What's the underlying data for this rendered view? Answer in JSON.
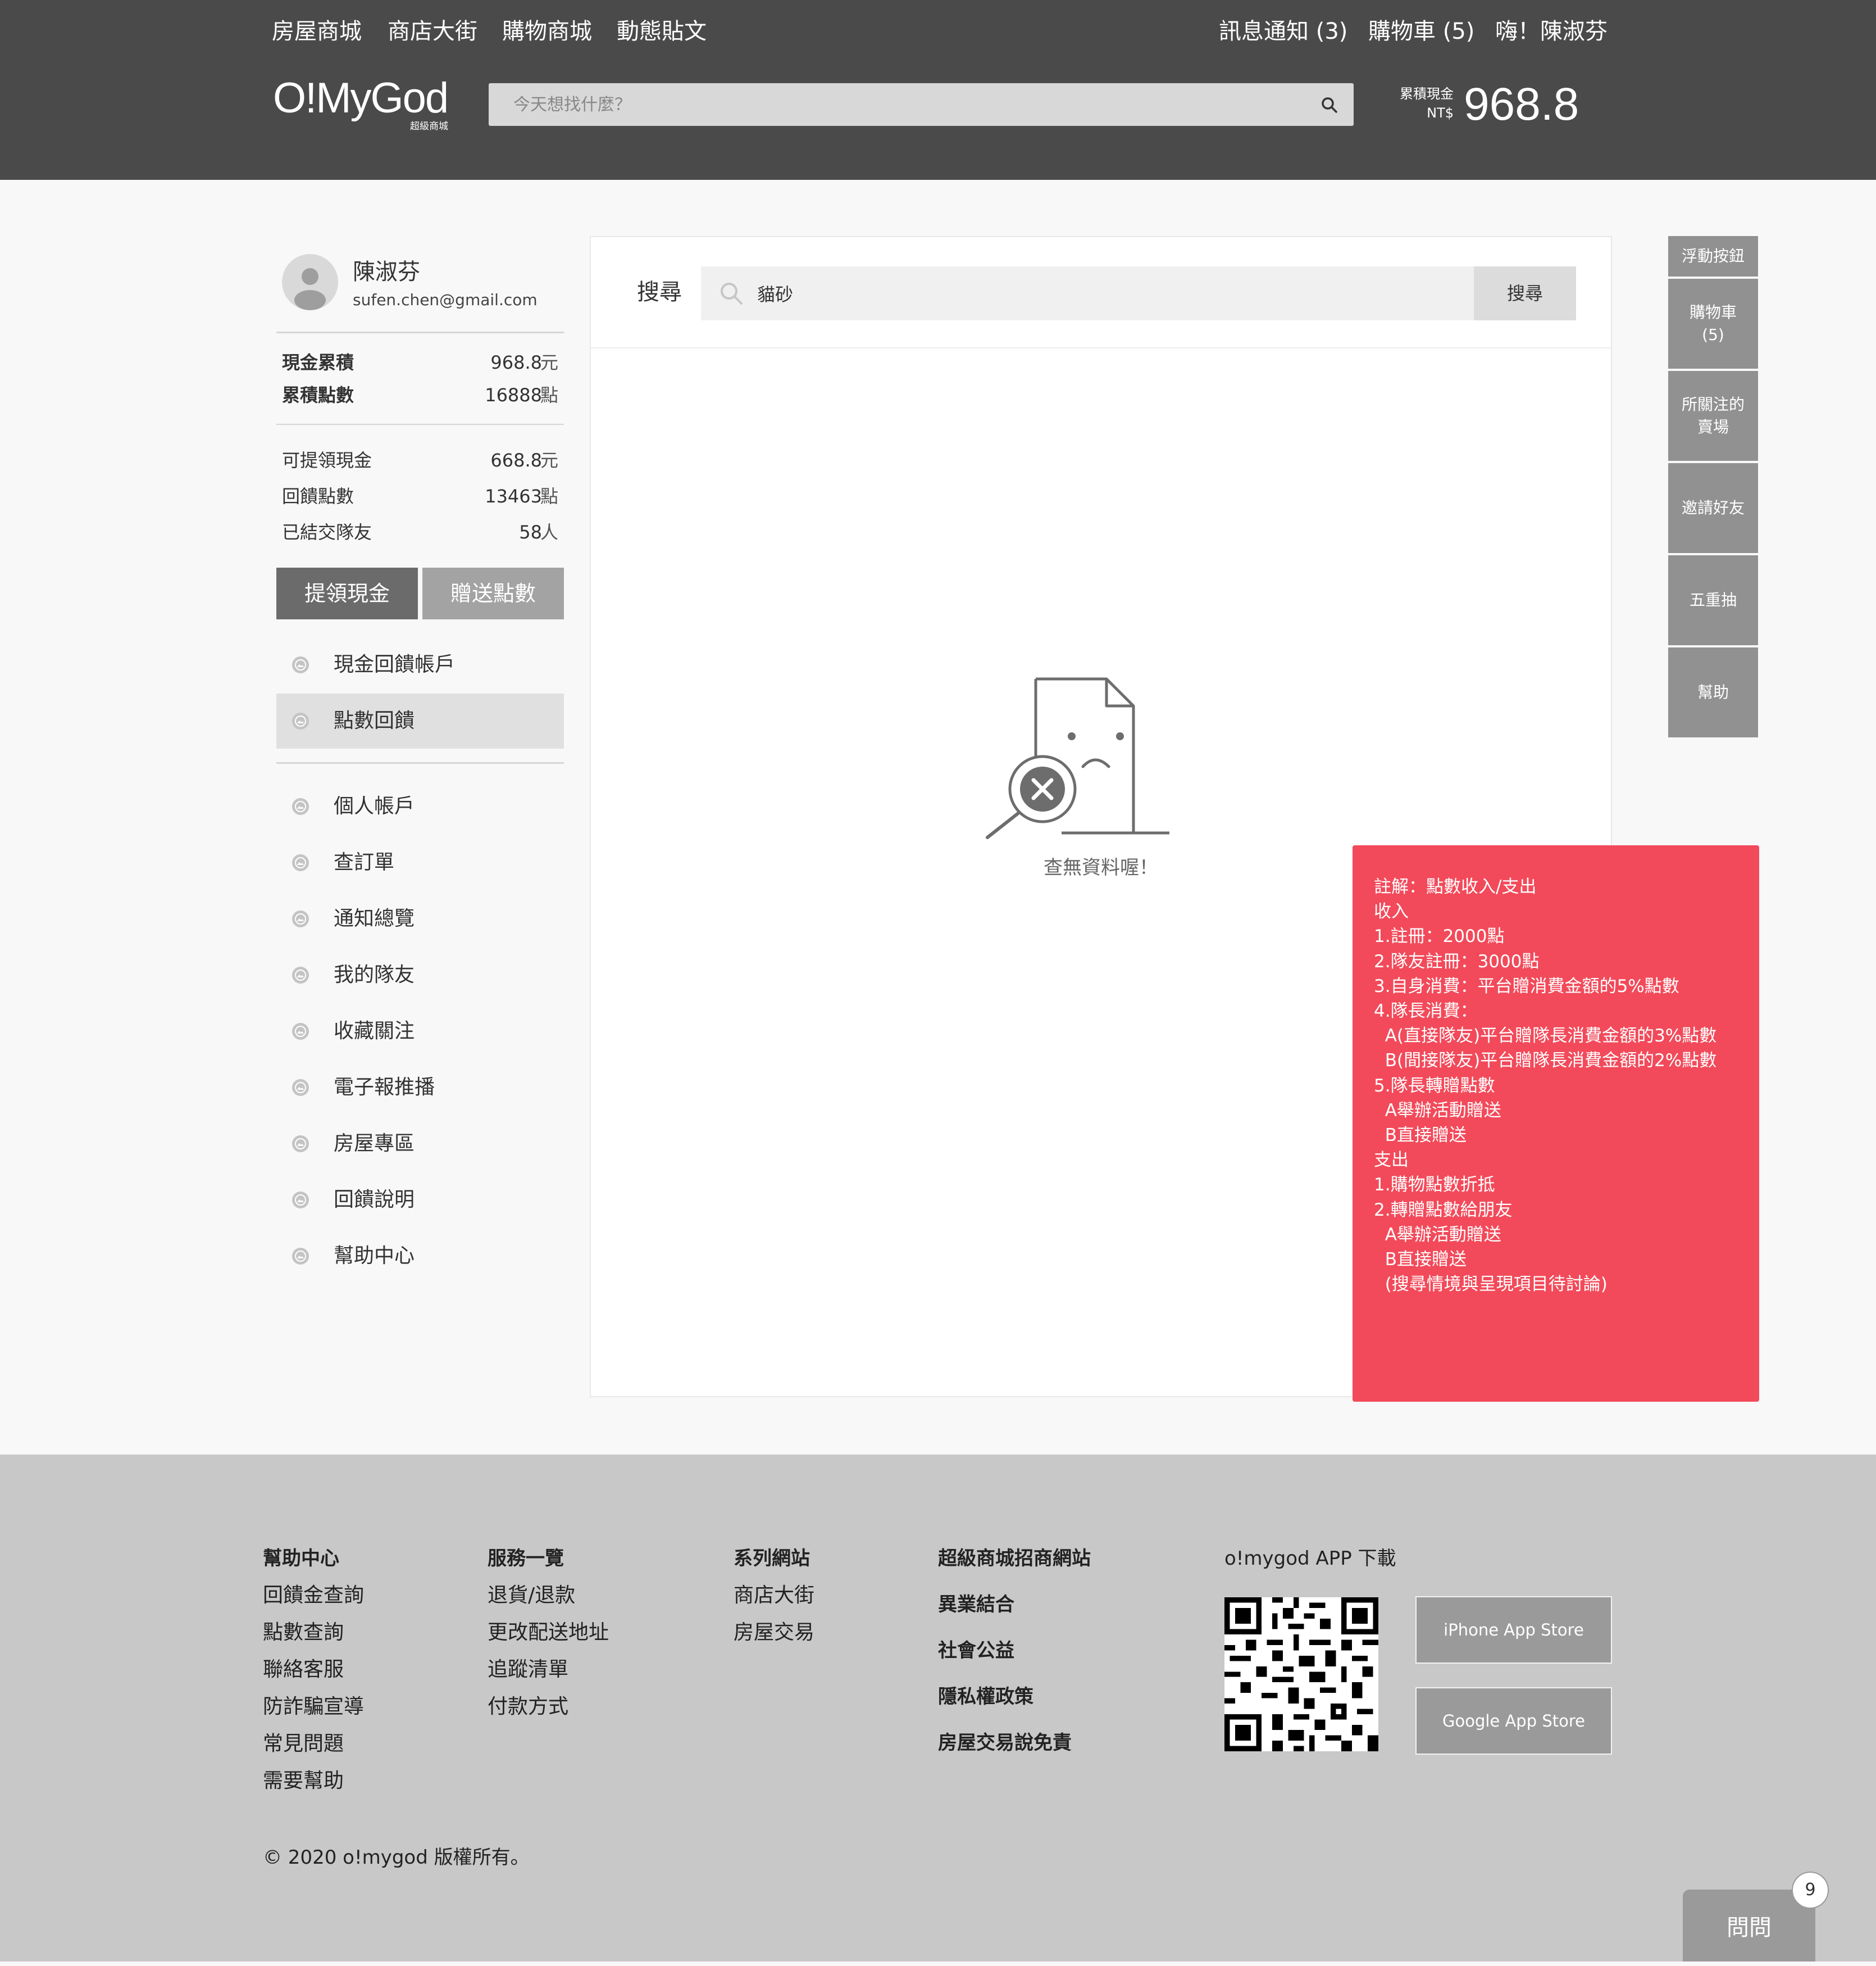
{
  "header": {
    "nav_left": [
      "房屋商城",
      "商店大街",
      "購物商城",
      "動態貼文"
    ],
    "notifications": "訊息通知 (3)",
    "cart": "購物車 (5)",
    "greeting": "嗨！陳淑芬",
    "logo": "O!MyGod",
    "logo_sub": "超級商城",
    "search_placeholder": "今天想找什麼？",
    "cash_label_line1": "累積現金",
    "cash_label_line2": "NT$",
    "cash_value": "968.8"
  },
  "sidebar": {
    "user_name": "陳淑芬",
    "user_email": "sufen.chen@gmail.com",
    "stats_top": [
      {
        "label": "現金累積",
        "value": "968.8",
        "unit": "元"
      },
      {
        "label": "累積點數",
        "value": "16888",
        "unit": "點"
      }
    ],
    "stats_bottom": [
      {
        "label": "可提領現金",
        "value": "668.8",
        "unit": "元"
      },
      {
        "label": "回饋點數",
        "value": "13463",
        "unit": "點"
      },
      {
        "label": "已結交隊友",
        "value": "58",
        "unit": "人"
      }
    ],
    "withdraw_button": "提領現金",
    "gift_button": "贈送點數",
    "menu_top": [
      "現金回饋帳戶",
      "點數回饋"
    ],
    "menu_bottom": [
      "個人帳戶",
      "查訂單",
      "通知總覽",
      "我的隊友",
      "收藏關注",
      "電子報推播",
      "房屋專區",
      "回饋說明",
      "幫助中心"
    ]
  },
  "main": {
    "search_label": "搜尋",
    "search_value": "貓砂",
    "search_button": "搜尋",
    "empty_text": "查無資料喔！"
  },
  "float_menu": [
    {
      "label": "浮動按鈕"
    },
    {
      "label": "購物車\n(5)"
    },
    {
      "label": "所關注的\n賣場"
    },
    {
      "label": "邀請好友"
    },
    {
      "label": "五重抽"
    },
    {
      "label": "幫助"
    }
  ],
  "note": {
    "lines": [
      "註解：點數收入/支出",
      "",
      "收入",
      "1.註冊：2000點",
      "2.隊友註冊：3000點",
      "3.自身消費：平台贈消費金額的5%點數",
      "4.隊長消費：",
      "  A(直接隊友)平台贈隊長消費金額的3%點數",
      "  B(間接隊友)平台贈隊長消費金額的2%點數",
      "5.隊長轉贈點數",
      "  A舉辦活動贈送",
      "  B直接贈送",
      "",
      "",
      "支出",
      "1.購物點數折抵",
      "2.轉贈點數給朋友",
      "  A舉辦活動贈送",
      "  B直接贈送",
      "",
      "  (搜尋情境與呈現項目待討論)"
    ]
  },
  "footer": {
    "col1": {
      "title": "幫助中心",
      "links": [
        "回饋金查詢",
        "點數查詢",
        "聯絡客服",
        "防詐騙宣導",
        "常見問題",
        "需要幫助"
      ]
    },
    "col2": {
      "title": "服務一覽",
      "links": [
        "退貨/退款",
        "更改配送地址",
        "追蹤清單",
        "付款方式"
      ]
    },
    "col3": {
      "title": "系列網站",
      "links": [
        "商店大街",
        "房屋交易"
      ]
    },
    "col4": {
      "links": [
        "超級商城招商網站",
        "異業結合",
        "社會公益",
        "隱私權政策",
        "房屋交易說免責"
      ]
    },
    "app_title": "o!mygod APP 下載",
    "iphone_store": "iPhone App Store",
    "google_store": "Google App Store",
    "copyright": "© 2020 o!mygod 版權所有。"
  },
  "chat": {
    "ask_label": "問問",
    "badge": "9"
  },
  "colors": {
    "header_bg": "#4a4a4a",
    "note_bg": "#f24a5a",
    "footer_bg": "#c8c8c8",
    "button_dark": "#6b6b6b",
    "button_light": "#a3a3a3"
  }
}
